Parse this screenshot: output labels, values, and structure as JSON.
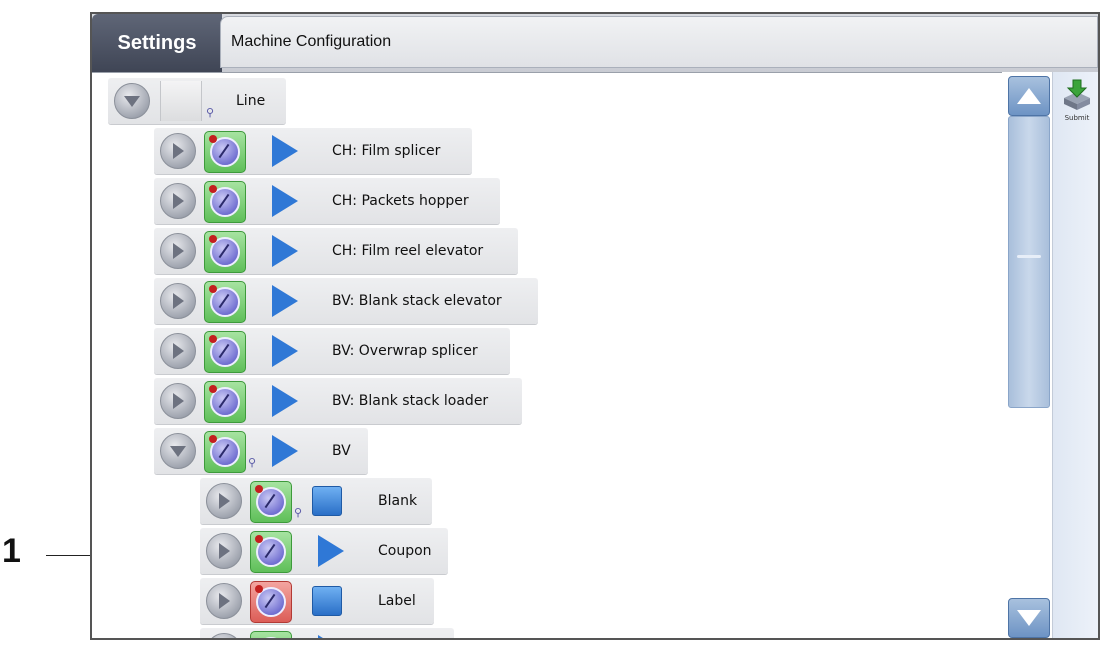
{
  "callout": {
    "number": "1"
  },
  "header": {
    "tab_label": "Settings",
    "title": "Machine Configuration"
  },
  "tree": {
    "root": {
      "label": "Line",
      "expanded": true
    },
    "items": [
      {
        "label": "CH: Film splicer",
        "expanded": false,
        "status": "green",
        "type": "play"
      },
      {
        "label": "CH: Packets hopper",
        "expanded": false,
        "status": "green",
        "type": "play"
      },
      {
        "label": "CH: Film reel elevator",
        "expanded": false,
        "status": "green",
        "type": "play"
      },
      {
        "label": "BV: Blank stack elevator",
        "expanded": false,
        "status": "green",
        "type": "play"
      },
      {
        "label": "BV: Overwrap splicer",
        "expanded": false,
        "status": "green",
        "type": "play"
      },
      {
        "label": "BV: Blank stack loader",
        "expanded": false,
        "status": "green",
        "type": "play"
      },
      {
        "label": "BV",
        "expanded": true,
        "status": "green",
        "type": "play",
        "children": [
          {
            "label": "Blank",
            "expanded": false,
            "status": "green",
            "type": "square"
          },
          {
            "label": "Coupon",
            "expanded": false,
            "status": "green",
            "type": "play"
          },
          {
            "label": "Label",
            "expanded": false,
            "status": "red",
            "type": "square"
          }
        ]
      }
    ]
  },
  "sidebar": {
    "submit_label": "Submit"
  },
  "icons": [
    "expand-icon",
    "gauge-icon",
    "play-icon",
    "square-icon",
    "scroll-up-icon",
    "scroll-down-icon",
    "submit-icon"
  ],
  "colors": {
    "status_green": "#5fbf59",
    "status_red": "#dc5d57",
    "accent_blue": "#2f78d6",
    "header_dark": "#3f4555"
  }
}
